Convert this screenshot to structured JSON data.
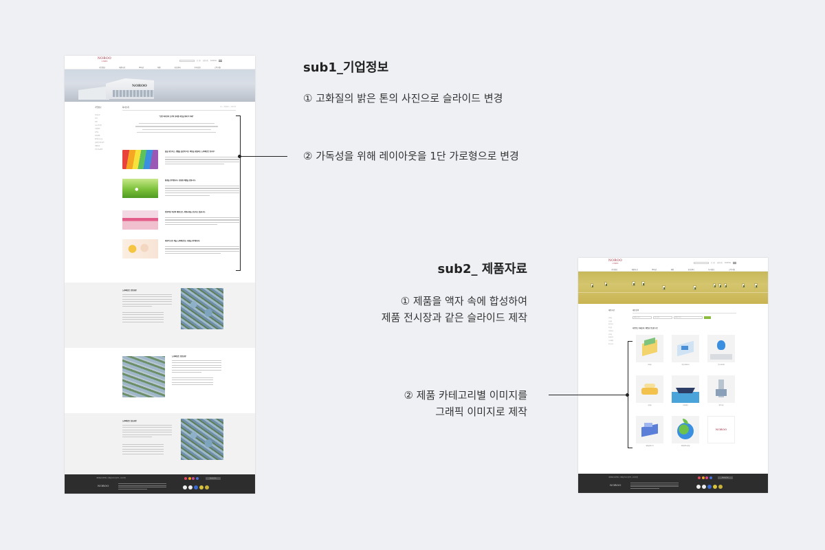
{
  "sub1": {
    "title": "sub1_기업정보",
    "note1": "① 고화질의 밝은 톤의 사진으로 슬라이드 변경",
    "note2": "② 가독성을 위해 레이아웃을 1단 가로형으로 변경",
    "mock": {
      "logo": "NOROO",
      "logo_sub": "노루페인트",
      "util": [
        "로그인",
        "회원가입",
        "KOREAN"
      ],
      "gnb": [
        "기업정보",
        "제품자료",
        "IR자료",
        "채용",
        "홍보센터",
        "투자정보",
        "고객지원"
      ],
      "hero_sign": "NOROO",
      "lnb_title": "기업정보",
      "lnb_items": [
        "회사소개",
        "연혁",
        "비전",
        "CEO인사말",
        "사업영역",
        "조직도",
        "윤리경영",
        "찾아오시는길",
        "글로벌 네트워크",
        "계열회사",
        "지속가능경영"
      ],
      "content_title": "회사소개",
      "breadcrumb": "홈 > 기업정보 > 회사소개",
      "intro_head": "\"안전 최우선의 조기적 성과를 추진을 통해 이 미래\"",
      "rows": [
        {
          "title": "삶을 창조하고, 생활을 즐겁게 하는 색상을 창출하는 노루페인트 입니다!"
        },
        {
          "title": "환경을 생각합니다. 친환경 제품을 만듭니다."
        },
        {
          "title": "전문적인 독보적 제품으로, 세계시장을 선도하고 있습니다."
        },
        {
          "title": "세상의 모든 색을 노루페인트는 사람을 생각합니다."
        }
      ],
      "sections": [
        {
          "title": "노루페인트 안양공장"
        },
        {
          "title": "노루페인트 천안공장"
        },
        {
          "title": "노루페인트 김포공장"
        }
      ],
      "footer_links": "개인정보처리방침 | 이메일무단수집거부 | 사이트맵",
      "footer_select": "Family Site"
    }
  },
  "sub2": {
    "title": "sub2_ 제품자료",
    "note1a": "① 제품을 액자 속에 합성하여",
    "note1b": "제품 전시장과 같은 슬라이드 제작",
    "note2a": "② 제품 카테고리별 이미지를",
    "note2b": "그래픽 이미지로 제작",
    "mock": {
      "logo": "NOROO",
      "logo_sub": "노루페인트",
      "util": [
        "로그인",
        "회원가입",
        "KOREAN"
      ],
      "gnb": [
        "기업정보",
        "제품자료",
        "IR자료",
        "채용",
        "홍보센터",
        "투자정보",
        "고객지원"
      ],
      "lnb_title": "제품자료",
      "lnb_items": [
        "건축용",
        "공업용",
        "중방식용",
        "목공용",
        "자동차용",
        "선박용",
        "분체도료",
        "기타제품",
        "특수도료"
      ],
      "content_title": "제품검색",
      "search": [
        "제품군 선택",
        "용도 선택",
        "제품명 입력"
      ],
      "tagline": "사용용도 카테고리 | 제품군 용도별 구분",
      "cards": [
        "건축용",
        "목공/인테리어",
        "방수/바닥재",
        "공업용",
        "선박/해양",
        "중방식용",
        "제품설계/수지",
        "친환경/탄소중립",
        "NOROO"
      ],
      "footer_links": "개인정보처리방침 | 이메일무단수집거부 | 사이트맵",
      "footer_select": "Family Site"
    }
  },
  "colors": {
    "brand": "#9b1b30",
    "footer": "#2d2d2d",
    "accent_green": "#8dbb3f",
    "hero_gold": "#c9b452",
    "background": "#eef0f4"
  }
}
